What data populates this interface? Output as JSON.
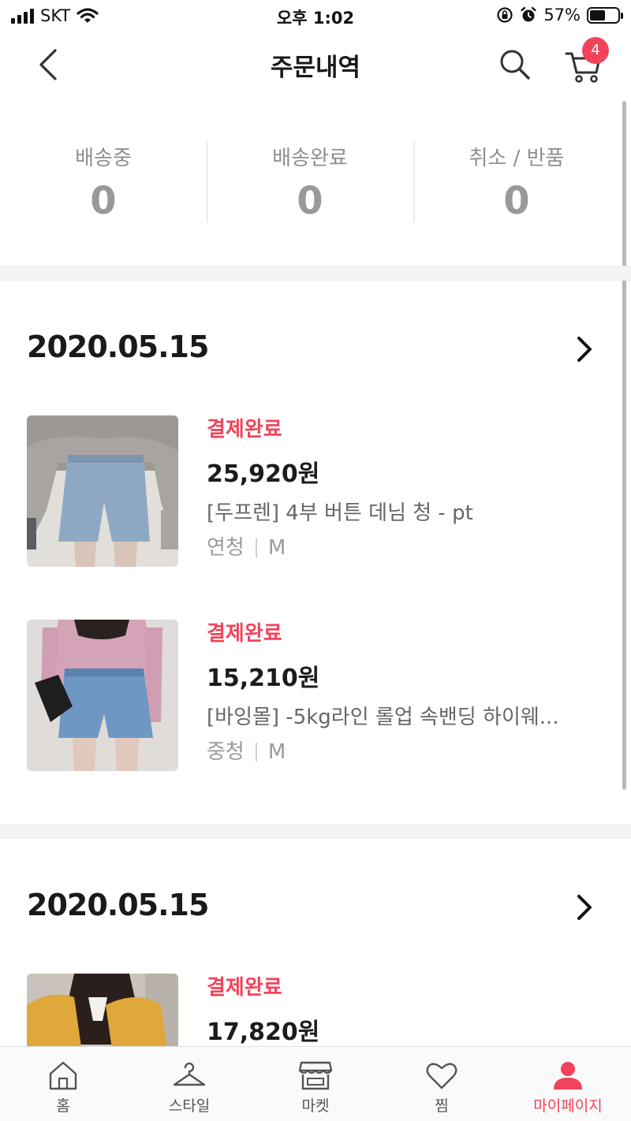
{
  "status_bar": {
    "carrier": "SKT",
    "time": "오후 1:02",
    "battery_percent": "57%",
    "battery_level": 0.57
  },
  "header": {
    "title": "주문내역",
    "cart_count": "4"
  },
  "summary": [
    {
      "label": "배송중",
      "count": "0"
    },
    {
      "label": "배송완료",
      "count": "0"
    },
    {
      "label": "취소 / 반품",
      "count": "0"
    }
  ],
  "orders": [
    {
      "date": "2020.05.15",
      "items": [
        {
          "status": "결제완료",
          "price": "25,920원",
          "name": "[두프렌] 4부 버튼 데님 청 - pt",
          "color": "연청",
          "size": "M"
        },
        {
          "status": "결제완료",
          "price": "15,210원",
          "name": "[바잉몰] -5kg라인 롤업 속밴딩 하이웨...",
          "color": "중청",
          "size": "M"
        }
      ]
    },
    {
      "date": "2020.05.15",
      "items": [
        {
          "status": "결제완료",
          "price": "17,820원"
        }
      ]
    }
  ],
  "tabs": [
    {
      "label": "홈",
      "icon": "home-icon"
    },
    {
      "label": "스타일",
      "icon": "hanger-icon"
    },
    {
      "label": "마켓",
      "icon": "store-icon"
    },
    {
      "label": "찜",
      "icon": "heart-icon"
    },
    {
      "label": "마이페이지",
      "icon": "person-icon",
      "active": true
    }
  ],
  "colors": {
    "accent": "#f2435b",
    "text_primary": "#1a1a1a",
    "text_muted": "#999999"
  }
}
